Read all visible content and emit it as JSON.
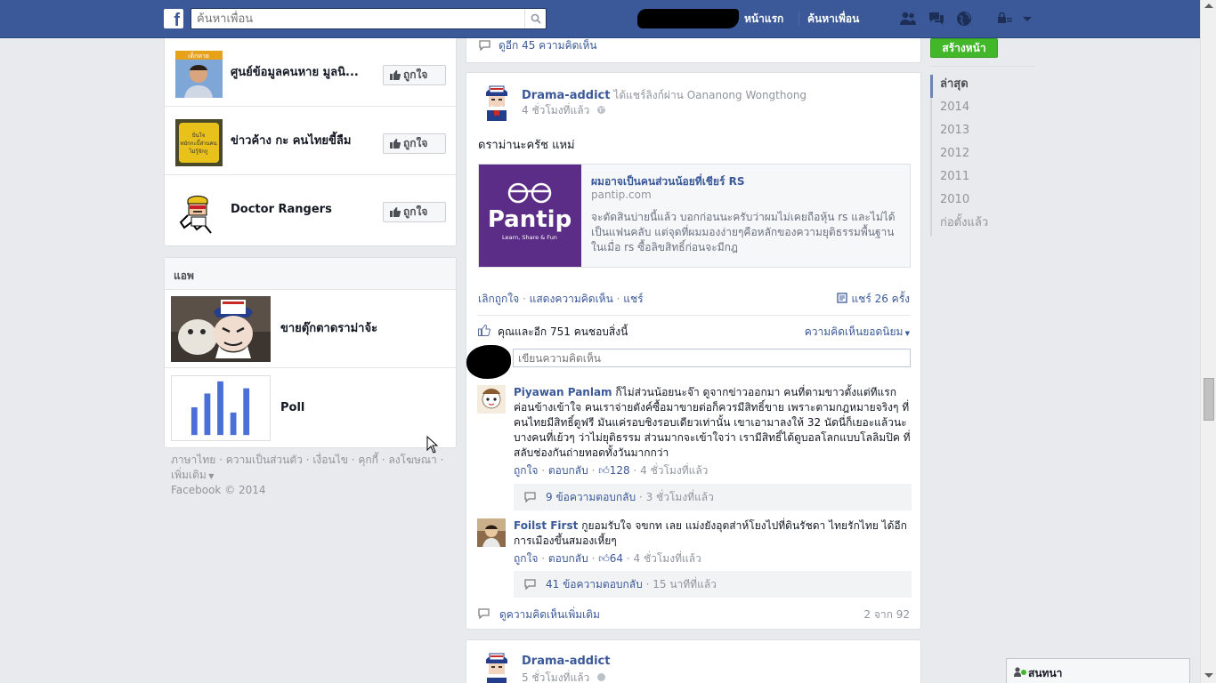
{
  "header": {
    "search_placeholder": "ค้นหาเพื่อน",
    "nav_home": "หน้าแรก",
    "nav_find_friends": "ค้นหาเพื่อน",
    "brand_color": "#3b5998"
  },
  "left": {
    "pages": [
      {
        "name": "ศูนย์ข้อมูลคนหาย มูลนิ...",
        "like_label": "ถูกใจ"
      },
      {
        "name": "ข่าวค้าง กะ คนไทยขี้ลืม",
        "like_label": "ถูกใจ"
      },
      {
        "name": "Doctor Rangers",
        "like_label": "ถูกใจ"
      }
    ],
    "apps_header": "แอพ",
    "apps": [
      {
        "name": "ขายตุ๊กตาดราม่าจ้ะ"
      },
      {
        "name": "Poll"
      }
    ],
    "footer_links": [
      "ภาษาไทย",
      "ความเป็นส่วนตัว",
      "เงื่อนไข",
      "คุกกี้",
      "ลงโฆษณา",
      "เพิ่มเติม"
    ],
    "copyright": "Facebook © 2014"
  },
  "main": {
    "prev_more_comments": "ดูอีก 45 ความคิดเห็น",
    "post": {
      "author": "Drama-addict",
      "action": "ได้แชร์ลิงก์ผ่าน Oananong Wongthong",
      "time": "4 ชั่วโมงที่แล้ว",
      "text": "ดราม่านะครัช แหม่",
      "link": {
        "image_brand": "Pantip",
        "image_tagline": "Learn, Share & Fun",
        "title": "ผมอาจเป็นคนส่วนน้อยที่เชียร์ RS",
        "domain": "pantip.com",
        "description": "จะตัดสินบ่ายนี้แล้ว บอกก่อนนะครับว่าผมไม่เคยถือหุ้น rs และไม่ได้เป็นแฟนคลับ แต่จุดที่ผมมองง่ายๆคือหลักของความยุติธรรมพื้นฐาน ในเมื่อ rs ซื้อลิขสิทธิ์ก่อนจะมีกฎ"
      },
      "actions": {
        "unlike": "เลิกถูกใจ",
        "show_comments": "แสดงความคิดเห็น",
        "share": "แชร์",
        "shares": "แชร์ 26 ครั้ง"
      },
      "likes_text": "คุณและอีก 751 คนชอบสิ่งนี้",
      "top_comments": "ความคิดเห็นยอดนิยม",
      "comment_placeholder": "เขียนความคิดเห็น",
      "comments": [
        {
          "author": "Piyawan Panlam",
          "text": "ก็ไม่ส่วนน้อยนะจ๊า ดูจากข่าวออกมา คนที่ตามขาวตั้งแต่ทีแรกค่อนข้างเข้าใจ คนเราจ่ายตังค์ซื้อมาขายต่อก็ควรมีสิทธิ์ขาย เพราะตามกฎหมายจริงๆ ที่คนไทยมีสิทธิ์ดูฟรี มันแค่รอบชิงรอบเดียวเท่านั้น เขาเอามาลงให้ 32 นัดนี่ก็เยอะแล้วนะ บางคนที่เย้วๆ ว่าไม่ยุติธรรม ส่วนมากจะเข้าใจว่า เรามีสิทธิ์ได้ดูบอลโลกแบบโลลิมปิค ที่สลับช่องกันถ่ายทอดทั้งวันมากกว่า",
          "like": "ถูกใจ",
          "reply": "ตอบกลับ",
          "likes": "128",
          "time": "4 ชั่วโมงที่แล้ว",
          "replies": "9 ข้อความตอบกลับ",
          "replies_time": "3 ชั่วโมงที่แล้ว"
        },
        {
          "author": "Foilst First",
          "text": "กูยอมรับใจ จขกท เลย แม่งยังอุตส่าห์โยงไปที่ดินรัชดา ไทยรักไทย ได้อีก การเมืองขึ้นสมองเหี้ยๆ",
          "like": "ถูกใจ",
          "reply": "ตอบกลับ",
          "likes": "64",
          "time": "4 ชั่วโมงที่แล้ว",
          "replies": "41 ข้อความตอบกลับ",
          "replies_time": "15 นาทีที่แล้ว"
        }
      ],
      "more_comments": "ดูความคิดเห็นเพิ่มเติม",
      "comment_count": "2 จาก 92"
    },
    "next_post": {
      "author": "Drama-addict",
      "time": "5 ชั่วโมงที่แล้ว"
    }
  },
  "right": {
    "create_page": "สร้างหน้า",
    "create_page_color": "#42b72a",
    "timeline": [
      "ล่าสุด",
      "2014",
      "2013",
      "2012",
      "2011",
      "2010",
      "ก่อตั้งแล้ว"
    ],
    "timeline_active": "ล่าสุด"
  },
  "chat": {
    "label": "สนทนา"
  }
}
